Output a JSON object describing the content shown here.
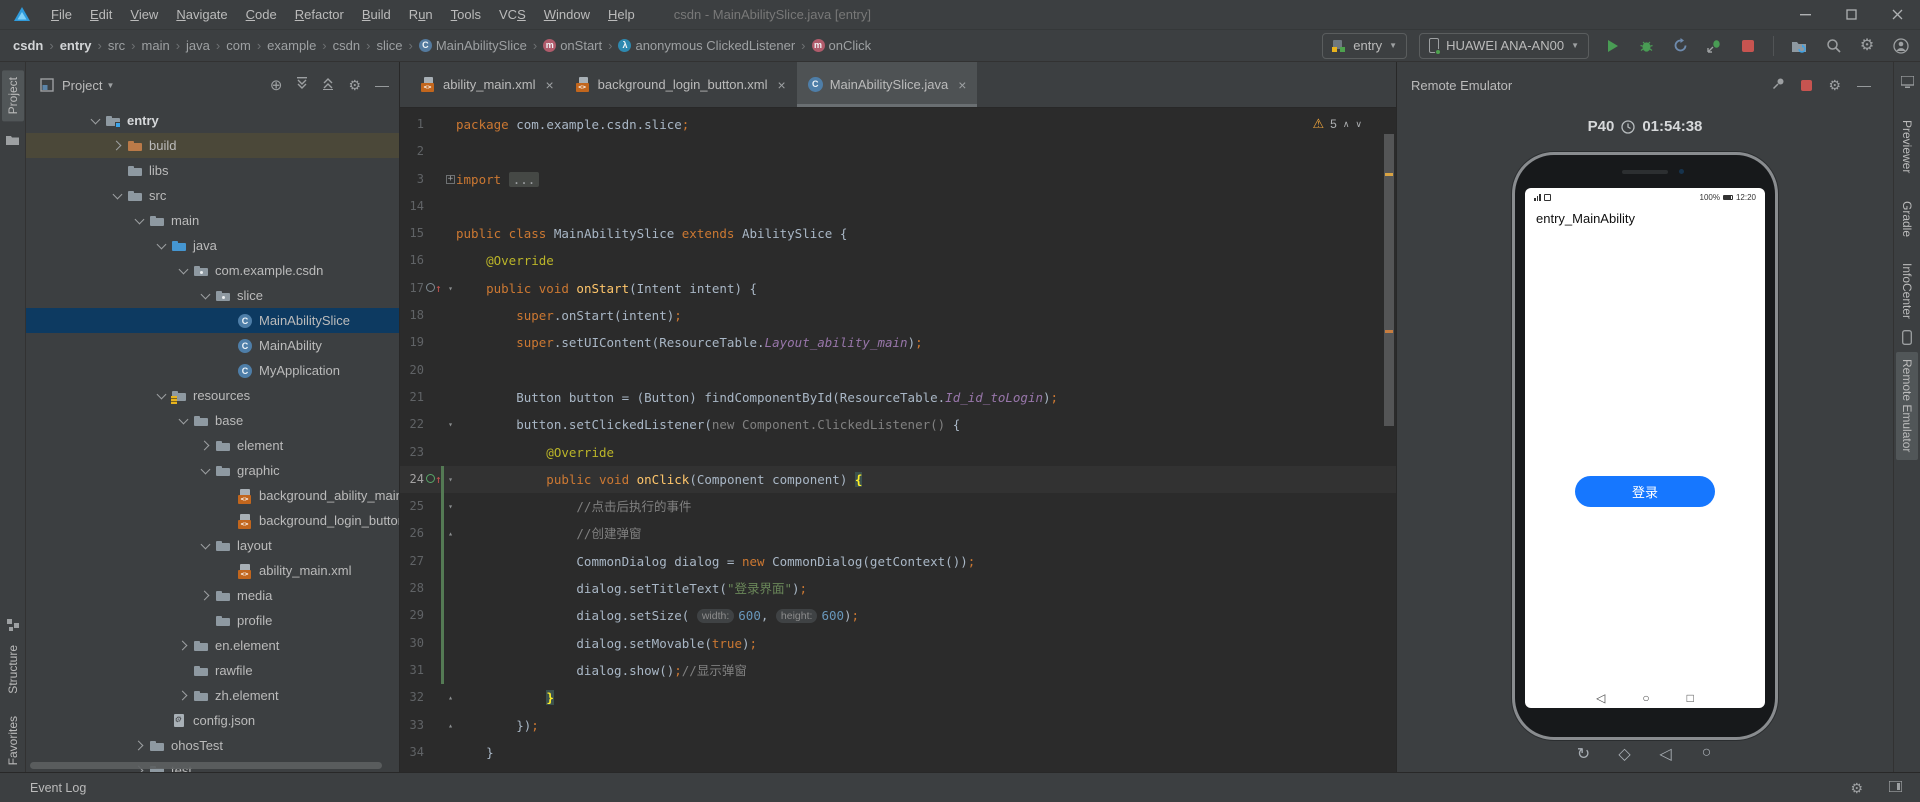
{
  "window": {
    "title": "csdn - MainAbilitySlice.java [entry]",
    "menus": [
      {
        "label": "File",
        "m": 0
      },
      {
        "label": "Edit",
        "m": 0
      },
      {
        "label": "View",
        "m": 0
      },
      {
        "label": "Navigate",
        "m": 0
      },
      {
        "label": "Code",
        "m": 0
      },
      {
        "label": "Refactor",
        "m": 0
      },
      {
        "label": "Build",
        "m": 0
      },
      {
        "label": "Run",
        "m": 1
      },
      {
        "label": "Tools",
        "m": 0
      },
      {
        "label": "VCS",
        "m": 2
      },
      {
        "label": "Window",
        "m": 0
      },
      {
        "label": "Help",
        "m": 0
      }
    ]
  },
  "toolbar": {
    "breadcrumbs": [
      {
        "label": "csdn",
        "bold": true
      },
      {
        "label": "entry",
        "bold": true
      },
      {
        "label": "src"
      },
      {
        "label": "main"
      },
      {
        "label": "java"
      },
      {
        "label": "com"
      },
      {
        "label": "example"
      },
      {
        "label": "csdn"
      },
      {
        "label": "slice"
      },
      {
        "label": "MainAbilitySlice",
        "icon": "class"
      },
      {
        "label": "onStart",
        "icon": "method"
      },
      {
        "label": "anonymous ClickedListener",
        "icon": "anon"
      },
      {
        "label": "onClick",
        "icon": "method"
      }
    ],
    "run_config": {
      "label": "entry"
    },
    "device": {
      "label": "HUAWEI ANA-AN00"
    }
  },
  "project": {
    "header": {
      "title": "Project"
    },
    "tree": [
      {
        "label": "entry",
        "d": 0,
        "icon": "folder-entry",
        "chev": "open",
        "bold": true
      },
      {
        "label": "build",
        "d": 1,
        "icon": "folder-build",
        "chev": "closed",
        "row": "context"
      },
      {
        "label": "libs",
        "d": 1,
        "icon": "folder"
      },
      {
        "label": "src",
        "d": 1,
        "icon": "folder",
        "chev": "open"
      },
      {
        "label": "main",
        "d": 2,
        "icon": "folder",
        "chev": "open"
      },
      {
        "label": "java",
        "d": 3,
        "icon": "folder-source",
        "chev": "open"
      },
      {
        "label": "com.example.csdn",
        "d": 4,
        "icon": "package",
        "chev": "open"
      },
      {
        "label": "slice",
        "d": 5,
        "icon": "package",
        "chev": "open"
      },
      {
        "label": "MainAbilitySlice",
        "d": 6,
        "icon": "class",
        "row": "selected"
      },
      {
        "label": "MainAbility",
        "d": 6,
        "icon": "class"
      },
      {
        "label": "MyApplication",
        "d": 6,
        "icon": "class"
      },
      {
        "label": "resources",
        "d": 3,
        "icon": "folder-resources",
        "chev": "open"
      },
      {
        "label": "base",
        "d": 4,
        "icon": "folder",
        "chev": "open"
      },
      {
        "label": "element",
        "d": 5,
        "icon": "folder",
        "chev": "closed"
      },
      {
        "label": "graphic",
        "d": 5,
        "icon": "folder",
        "chev": "open"
      },
      {
        "label": "background_ability_main.xml",
        "d": 6,
        "icon": "xml"
      },
      {
        "label": "background_login_button.xml",
        "d": 6,
        "icon": "xml"
      },
      {
        "label": "layout",
        "d": 5,
        "icon": "folder",
        "chev": "open"
      },
      {
        "label": "ability_main.xml",
        "d": 6,
        "icon": "xml"
      },
      {
        "label": "media",
        "d": 5,
        "icon": "folder",
        "chev": "closed"
      },
      {
        "label": "profile",
        "d": 5,
        "icon": "folder"
      },
      {
        "label": "en.element",
        "d": 4,
        "icon": "folder",
        "chev": "closed"
      },
      {
        "label": "rawfile",
        "d": 4,
        "icon": "folder"
      },
      {
        "label": "zh.element",
        "d": 4,
        "icon": "folder",
        "chev": "closed"
      },
      {
        "label": "config.json",
        "d": 3,
        "icon": "json"
      },
      {
        "label": "ohosTest",
        "d": 2,
        "icon": "folder",
        "chev": "closed"
      },
      {
        "label": "test",
        "d": 2,
        "icon": "folder",
        "chev": "closed"
      }
    ]
  },
  "editor": {
    "tabs": [
      {
        "label": "ability_main.xml",
        "icon": "xml",
        "active": false
      },
      {
        "label": "background_login_button.xml",
        "icon": "xml",
        "active": false
      },
      {
        "label": "MainAbilitySlice.java",
        "icon": "class",
        "active": true
      }
    ],
    "warnings": {
      "count": "5"
    },
    "lines": [
      {
        "n": "1",
        "segs": [
          [
            "kw",
            "package"
          ],
          [
            "def",
            " com.example.csdn.slice"
          ],
          [
            "semi",
            ";"
          ]
        ]
      },
      {
        "n": "2",
        "segs": []
      },
      {
        "n": "3",
        "segs": [
          [
            "kw",
            "import "
          ],
          [
            "foldtxt",
            "..."
          ]
        ],
        "fold": "plus"
      },
      {
        "n": "14",
        "segs": []
      },
      {
        "n": "15",
        "segs": [
          [
            "kw",
            "public class "
          ],
          [
            "def",
            "MainAbilitySlice "
          ],
          [
            "kw",
            "extends "
          ],
          [
            "def",
            "AbilitySlice {"
          ]
        ]
      },
      {
        "n": "16",
        "segs": [
          [
            "ann",
            "    @Override"
          ]
        ]
      },
      {
        "n": "17",
        "segs": [
          [
            "kw",
            "    public void "
          ],
          [
            "fn",
            "onStart"
          ],
          [
            "def",
            "(Intent intent) {"
          ]
        ],
        "fold": "open",
        "ovr": "gray"
      },
      {
        "n": "18",
        "segs": [
          [
            "kw",
            "        super"
          ],
          [
            "def",
            ".onStart(intent)"
          ],
          [
            "semi",
            ";"
          ]
        ]
      },
      {
        "n": "19",
        "segs": [
          [
            "kw",
            "        super"
          ],
          [
            "def",
            ".setUIContent(ResourceTable."
          ],
          [
            "fld",
            "Layout_ability_main"
          ],
          [
            "def",
            ")"
          ],
          [
            "semi",
            ";"
          ]
        ]
      },
      {
        "n": "20",
        "segs": []
      },
      {
        "n": "21",
        "segs": [
          [
            "def",
            "        Button button = (Button) findComponentById(ResourceTable."
          ],
          [
            "fld",
            "Id_id_toLogin"
          ],
          [
            "def",
            ")"
          ],
          [
            "semi",
            ";"
          ]
        ]
      },
      {
        "n": "22",
        "segs": [
          [
            "def",
            "        button.setClickedListener("
          ],
          [
            "gray",
            "new Component.ClickedListener() "
          ],
          [
            "def",
            "{"
          ]
        ],
        "fold": "open"
      },
      {
        "n": "23",
        "segs": [
          [
            "ann",
            "            @Override"
          ]
        ]
      },
      {
        "n": "24",
        "segs": [
          [
            "kw",
            "            public void "
          ],
          [
            "fn",
            "onClick"
          ],
          [
            "def",
            "(Component component) "
          ],
          [
            "brace",
            "{"
          ]
        ],
        "fold": "open",
        "ovr": "green",
        "cur": true,
        "chg": true
      },
      {
        "n": "25",
        "segs": [
          [
            "cmt",
            "                //点击后执行的事件"
          ]
        ],
        "fold": "open",
        "chg": true
      },
      {
        "n": "26",
        "segs": [
          [
            "cmt",
            "                //创建弹窗"
          ]
        ],
        "fold": "close",
        "chg": true
      },
      {
        "n": "27",
        "segs": [
          [
            "def",
            "                CommonDialog dialog = "
          ],
          [
            "kw",
            "new"
          ],
          [
            "def",
            " CommonDialog(getContext())"
          ],
          [
            "semi",
            ";"
          ]
        ],
        "chg": true
      },
      {
        "n": "28",
        "segs": [
          [
            "def",
            "                dialog.setTitleText("
          ],
          [
            "str",
            "\"登录界面\""
          ],
          [
            "def",
            ")"
          ],
          [
            "semi",
            ";"
          ]
        ],
        "chg": true
      },
      {
        "n": "29",
        "segs": [
          [
            "def",
            "                dialog.setSize( "
          ],
          [
            "hint",
            "width:"
          ],
          [
            "num2",
            "600"
          ],
          [
            "def",
            ", "
          ],
          [
            "hint",
            "height:"
          ],
          [
            "num2",
            "600"
          ],
          [
            "def",
            ")"
          ],
          [
            "semi",
            ";"
          ]
        ],
        "chg": true
      },
      {
        "n": "30",
        "segs": [
          [
            "def",
            "                dialog.setMovable("
          ],
          [
            "kw",
            "true"
          ],
          [
            "def",
            ")"
          ],
          [
            "semi",
            ";"
          ]
        ],
        "chg": true
      },
      {
        "n": "31",
        "segs": [
          [
            "def",
            "                dialog.show()"
          ],
          [
            "semi",
            ";"
          ],
          [
            "cmt",
            "//显示弹窗"
          ]
        ],
        "chg": true
      },
      {
        "n": "32",
        "segs": [
          [
            "def",
            "            "
          ],
          [
            "brace",
            "}"
          ]
        ],
        "fold": "close"
      },
      {
        "n": "33",
        "segs": [
          [
            "def",
            "        })"
          ],
          [
            "semi",
            ";"
          ]
        ],
        "fold": "close"
      },
      {
        "n": "34",
        "segs": [
          [
            "def",
            "    }"
          ]
        ]
      }
    ]
  },
  "emulator": {
    "panel_title": "Remote Emulator",
    "device_name": "P40",
    "uptime": "01:54:38",
    "phone": {
      "battery": "100%",
      "clock": "12:20",
      "app_title": "entry_MainAbility",
      "login_button": "登录"
    },
    "controls": [
      "rotate",
      "multiwindow",
      "back",
      "home"
    ]
  },
  "right_strip": {
    "tabs": [
      {
        "label": "Previewer"
      },
      {
        "label": "Gradle"
      },
      {
        "label": "InfoCenter"
      },
      {
        "label": "Remote Emulator",
        "active": true
      }
    ]
  },
  "left_strip": {
    "top": {
      "label": "Project"
    },
    "bottom": [
      {
        "label": "Structure"
      },
      {
        "label": "Favorites"
      }
    ]
  },
  "status_bar": {
    "event_log": "Event Log"
  },
  "colors": {
    "accent_blue": "#1677ff",
    "run_green": "#499c54",
    "stop_red": "#c75450",
    "warning_yellow": "#f2a63c",
    "selection_blue": "#0d3a61",
    "keyword_orange": "#cc7832"
  }
}
